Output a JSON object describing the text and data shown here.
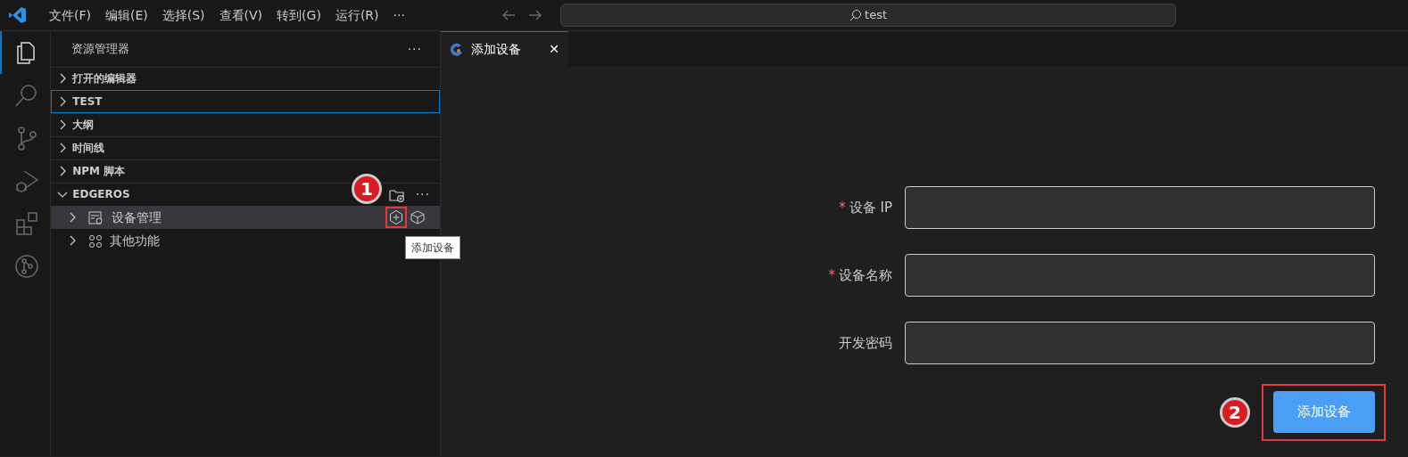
{
  "menu": [
    "文件(F)",
    "编辑(E)",
    "选择(S)",
    "查看(V)",
    "转到(G)",
    "运行(R)",
    "···"
  ],
  "search": {
    "value": "test"
  },
  "activity_bar": [
    {
      "kind": "files",
      "selected": true
    },
    {
      "kind": "search",
      "selected": false
    },
    {
      "kind": "branch",
      "selected": false
    },
    {
      "kind": "debug",
      "selected": false
    },
    {
      "kind": "extensions",
      "selected": false
    },
    {
      "kind": "git",
      "selected": false
    }
  ],
  "sidebar": {
    "title": "资源管理器",
    "more": "···",
    "sections": [
      {
        "label": "打开的编辑器",
        "expanded": false,
        "focused": false
      },
      {
        "label": "TEST",
        "expanded": false,
        "focused": true
      },
      {
        "label": "大纲",
        "expanded": false,
        "focused": false
      },
      {
        "label": "时间线",
        "expanded": false,
        "focused": false
      },
      {
        "label": "NPM 脚本",
        "expanded": false,
        "focused": false
      },
      {
        "label": "EDGEROS",
        "expanded": true,
        "focused": false,
        "more": "···",
        "children": [
          {
            "label": "设备管理",
            "kind": "device",
            "selected": true
          },
          {
            "label": "其他功能",
            "kind": "apps",
            "selected": false
          }
        ]
      }
    ]
  },
  "tooltip": "添加设备",
  "tab": {
    "label": "添加设备",
    "close": "✕"
  },
  "form": {
    "required_mark": "*",
    "fields": [
      {
        "label": "设备 IP",
        "required": true
      },
      {
        "label": "设备名称",
        "required": true
      },
      {
        "label": "开发密码",
        "required": false
      }
    ],
    "submit": "添加设备"
  },
  "annotations": [
    "1",
    "2"
  ]
}
